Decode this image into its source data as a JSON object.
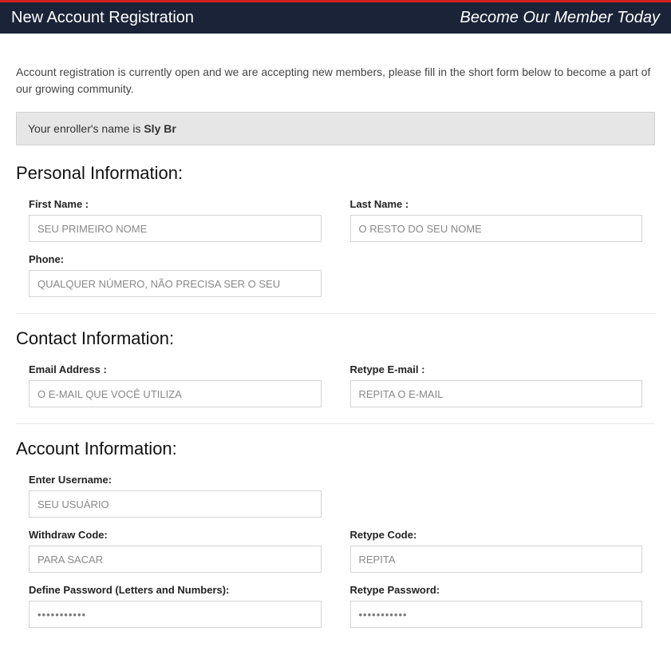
{
  "header": {
    "title": "New Account Registration",
    "tagline": "Become Our Member Today"
  },
  "intro": "Account registration is currently open and we are accepting new members, please fill in the short form below to become a part of our growing community.",
  "enroller": {
    "prefix": "Your enroller's name is ",
    "name": "Sly Br"
  },
  "sections": {
    "personal": "Personal Information:",
    "contact": "Contact Information:",
    "account": "Account Information:"
  },
  "fields": {
    "first_name": {
      "label": "First Name :",
      "value": "SEU PRIMEIRO NOME"
    },
    "last_name": {
      "label": "Last Name :",
      "value": "O RESTO DO SEU NOME"
    },
    "phone": {
      "label": "Phone:",
      "value": "QUALQUER NÚMERO, NÃO PRECISA SER O SEU"
    },
    "email": {
      "label": "Email Address :",
      "value": "O E-MAIL QUE VOCÊ UTILIZA"
    },
    "retype_email": {
      "label": "Retype E-mail :",
      "value": "REPITA O E-MAIL"
    },
    "username": {
      "label": "Enter Username:",
      "value": "SEU USUÁRIO"
    },
    "withdraw_code": {
      "label": "Withdraw Code:",
      "value": "PARA SACAR"
    },
    "retype_code": {
      "label": "Retype Code:",
      "value": "REPITA"
    },
    "password": {
      "label": "Define Password (Letters and Numbers):",
      "value": "•••••••••••"
    },
    "retype_password": {
      "label": "Retype Password:",
      "value": "•••••••••••"
    }
  }
}
